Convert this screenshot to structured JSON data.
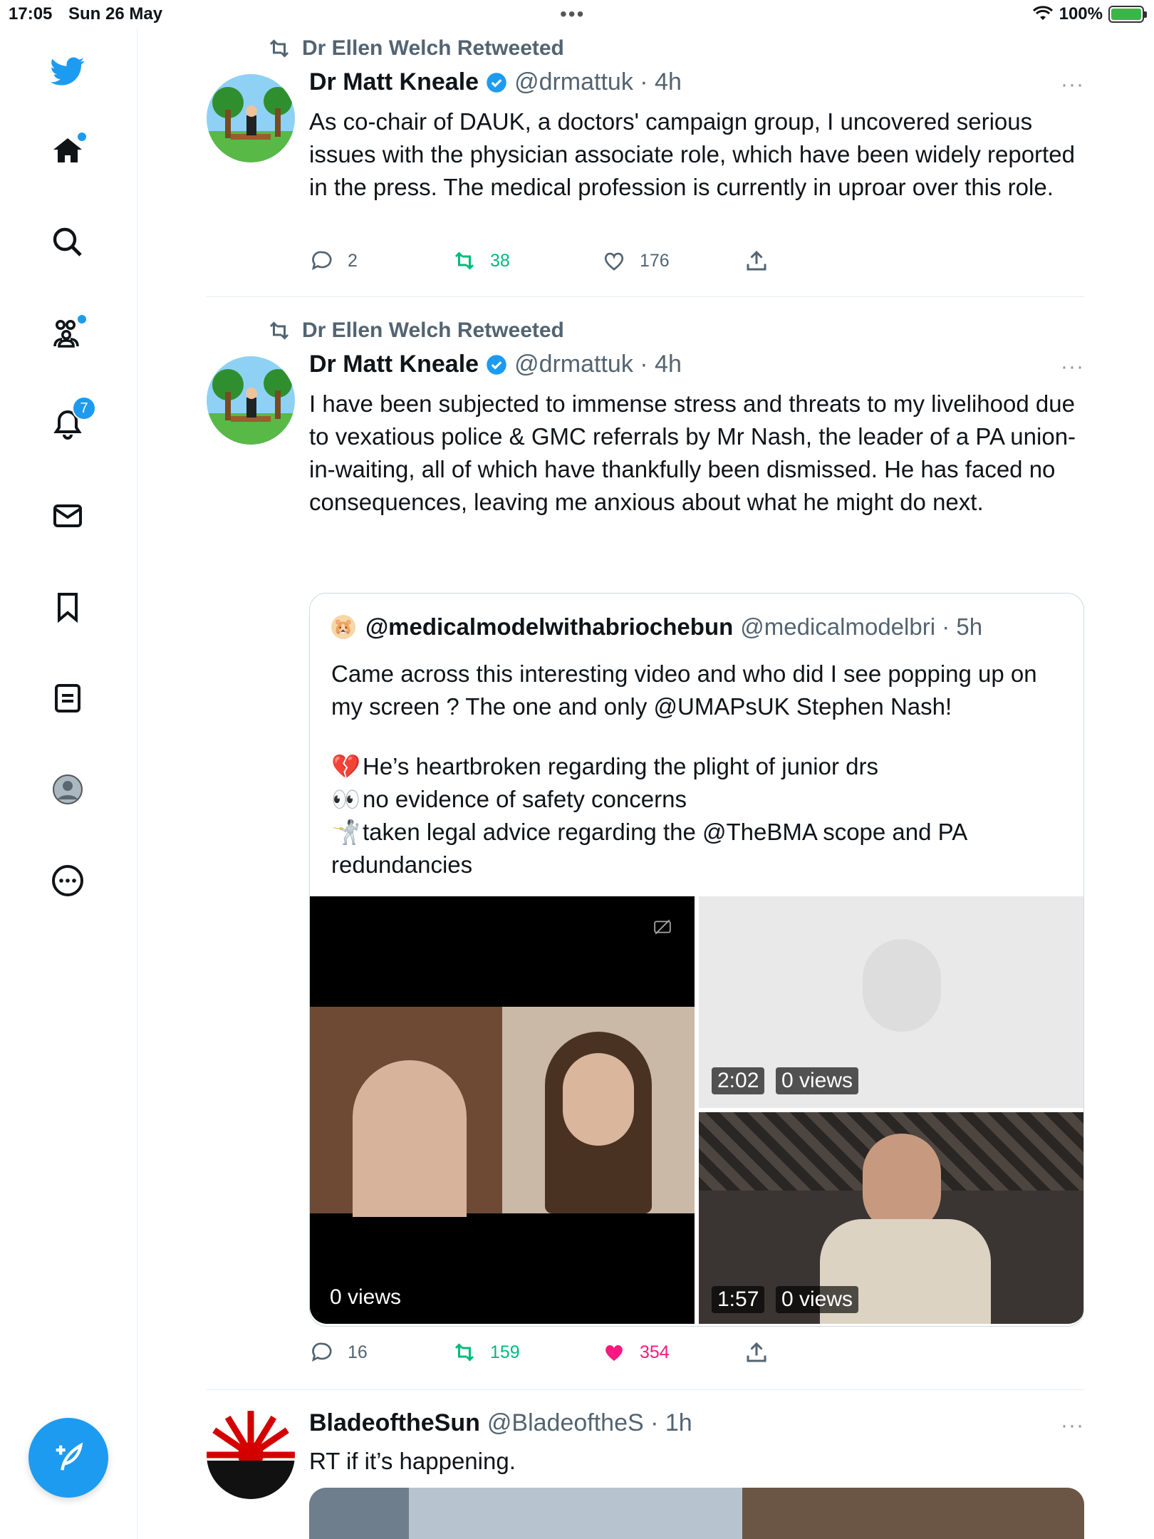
{
  "status_bar": {
    "time": "17:05",
    "date": "Sun 26 May",
    "battery": "100%"
  },
  "sidebar": {
    "items": [
      {
        "name": "home",
        "badge": ""
      },
      {
        "name": "explore",
        "badge": ""
      },
      {
        "name": "communities",
        "badge": ""
      },
      {
        "name": "notifications",
        "badge": "7"
      },
      {
        "name": "messages",
        "badge": ""
      },
      {
        "name": "bookmarks",
        "badge": ""
      },
      {
        "name": "lists",
        "badge": ""
      },
      {
        "name": "profile",
        "badge": ""
      },
      {
        "name": "more",
        "badge": ""
      }
    ],
    "accent": "#1d9bf0"
  },
  "tweets": [
    {
      "retweeted_by": "Dr Ellen Welch Retweeted",
      "name": "Dr Matt Kneale",
      "handle": "@drmattuk · 4h",
      "text": "As co-chair of DAUK, a doctors' campaign group, I uncovered serious issues with the physician associate role, which have been widely reported in the press. The medical profession is currently in uproar over this role.",
      "replies": "2",
      "retweets": "38",
      "likes": "176",
      "more": "···"
    },
    {
      "retweeted_by": "Dr Ellen Welch Retweeted",
      "name": "Dr Matt Kneale",
      "handle": "@drmattuk · 4h",
      "text": "I have been subjected to immense stress and threats to my livelihood due to vexatious police & GMC referrals by Mr Nash, the leader of a PA union-in-waiting, all of which have thankfully been dismissed. He has faced no consequences, leaving me anxious about what he might do next.",
      "replies": "16",
      "retweets": "159",
      "likes": "354",
      "more": "···",
      "quote": {
        "name": "@medicalmodelwithabriochebun",
        "handle": "@medicalmodelbri · 5h",
        "text": "Came across this interesting video and who did I see popping up on my screen ? The one and only @UMAPsUK Stephen Nash!",
        "lines": [
          {
            "emoji": "💔",
            "text": "He’s heartbroken regarding the plight of junior drs"
          },
          {
            "emoji": "👀",
            "text": "no evidence of safety concerns"
          },
          {
            "emoji": "🤺",
            "text": "taken legal advice regarding the @TheBMA scope and PA"
          }
        ],
        "last_line": "redundancies",
        "media": {
          "left_views": "0 views",
          "top_right_duration": "2:02",
          "top_right_views": "0 views",
          "bottom_right_duration": "1:57",
          "bottom_right_views": "0 views"
        }
      }
    },
    {
      "name": "BladeoftheSun",
      "handle": "@BladeoftheS · 1h",
      "text": "RT if it’s happening.",
      "more": "···"
    }
  ]
}
